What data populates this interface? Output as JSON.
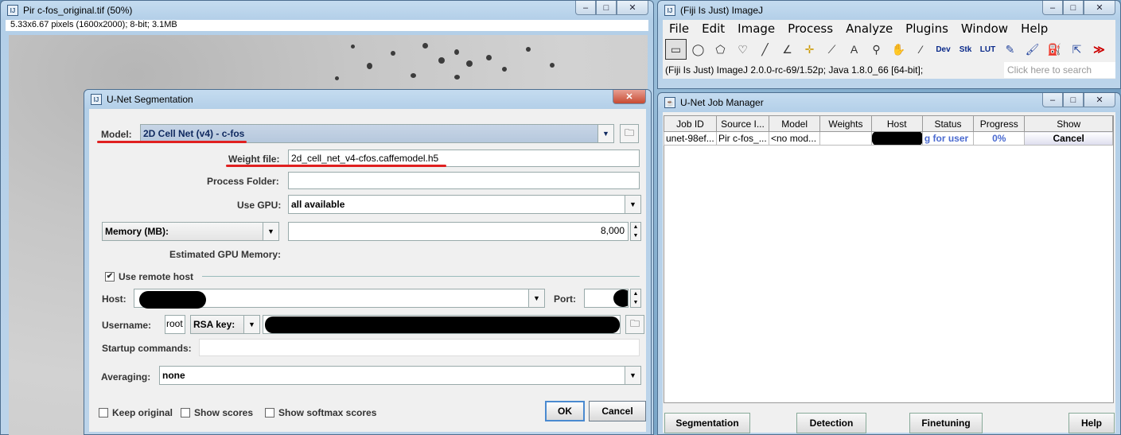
{
  "image_window": {
    "title": "Pir c-fos_original.tif (50%)",
    "info": "5.33x6.67 pixels (1600x2000); 8-bit; 3.1MB"
  },
  "imagej": {
    "title": "(Fiji Is Just) ImageJ",
    "menu": [
      "File",
      "Edit",
      "Image",
      "Process",
      "Analyze",
      "Plugins",
      "Window",
      "Help"
    ],
    "tools": [
      "rectangle-tool",
      "oval-tool",
      "polygon-tool",
      "freehand-tool",
      "line-tool",
      "angle-tool",
      "point-tool",
      "wand-tool",
      "text-tool",
      "zoom-tool",
      "hand-tool",
      "color-picker-tool"
    ],
    "tool_labels": [
      "Dev",
      "Stk",
      "LUT"
    ],
    "more_label": "≫",
    "status": "(Fiji Is Just) ImageJ 2.0.0-rc-69/1.52p; Java 1.8.0_66 [64-bit];",
    "search_placeholder": "Click here to search"
  },
  "job_manager": {
    "title": "U-Net Job Manager",
    "columns": [
      "Job ID",
      "Source I...",
      "Model",
      "Weights",
      "Host",
      "Status",
      "Progress",
      "Show"
    ],
    "rows": [
      {
        "job_id": "unet-98ef...",
        "source": "Pir c-fos_...",
        "model": "<no mod...",
        "weights": "",
        "host": "",
        "status": "g for user",
        "progress": "0%",
        "show": "Cancel"
      }
    ],
    "buttons": {
      "segmentation": "Segmentation",
      "detection": "Detection",
      "finetuning": "Finetuning",
      "help": "Help"
    }
  },
  "dialog": {
    "title": "U-Net Segmentation",
    "model_label": "Model:",
    "model_value": "2D Cell Net (v4) - c-fos",
    "weight_label": "Weight file:",
    "weight_value": "2d_cell_net_v4-cfos.caffemodel.h5",
    "process_folder_label": "Process Folder:",
    "process_folder_value": "",
    "use_gpu_label": "Use GPU:",
    "use_gpu_value": "all available",
    "memory_label": "Memory (MB):",
    "memory_value": "8,000",
    "est_gpu_label": "Estimated GPU Memory:",
    "use_remote_label": "Use remote host",
    "use_remote_checked": true,
    "host_label": "Host:",
    "port_label": "Port:",
    "username_label": "Username:",
    "username_value": "root",
    "rsa_label": "RSA key:",
    "startup_label": "Startup commands:",
    "averaging_label": "Averaging:",
    "averaging_value": "none",
    "keep_original_label": "Keep original",
    "show_scores_label": "Show scores",
    "show_softmax_label": "Show softmax scores",
    "ok_label": "OK",
    "cancel_label": "Cancel"
  },
  "window_controls": {
    "minimize": "–",
    "maximize": "□",
    "close": "✕"
  }
}
